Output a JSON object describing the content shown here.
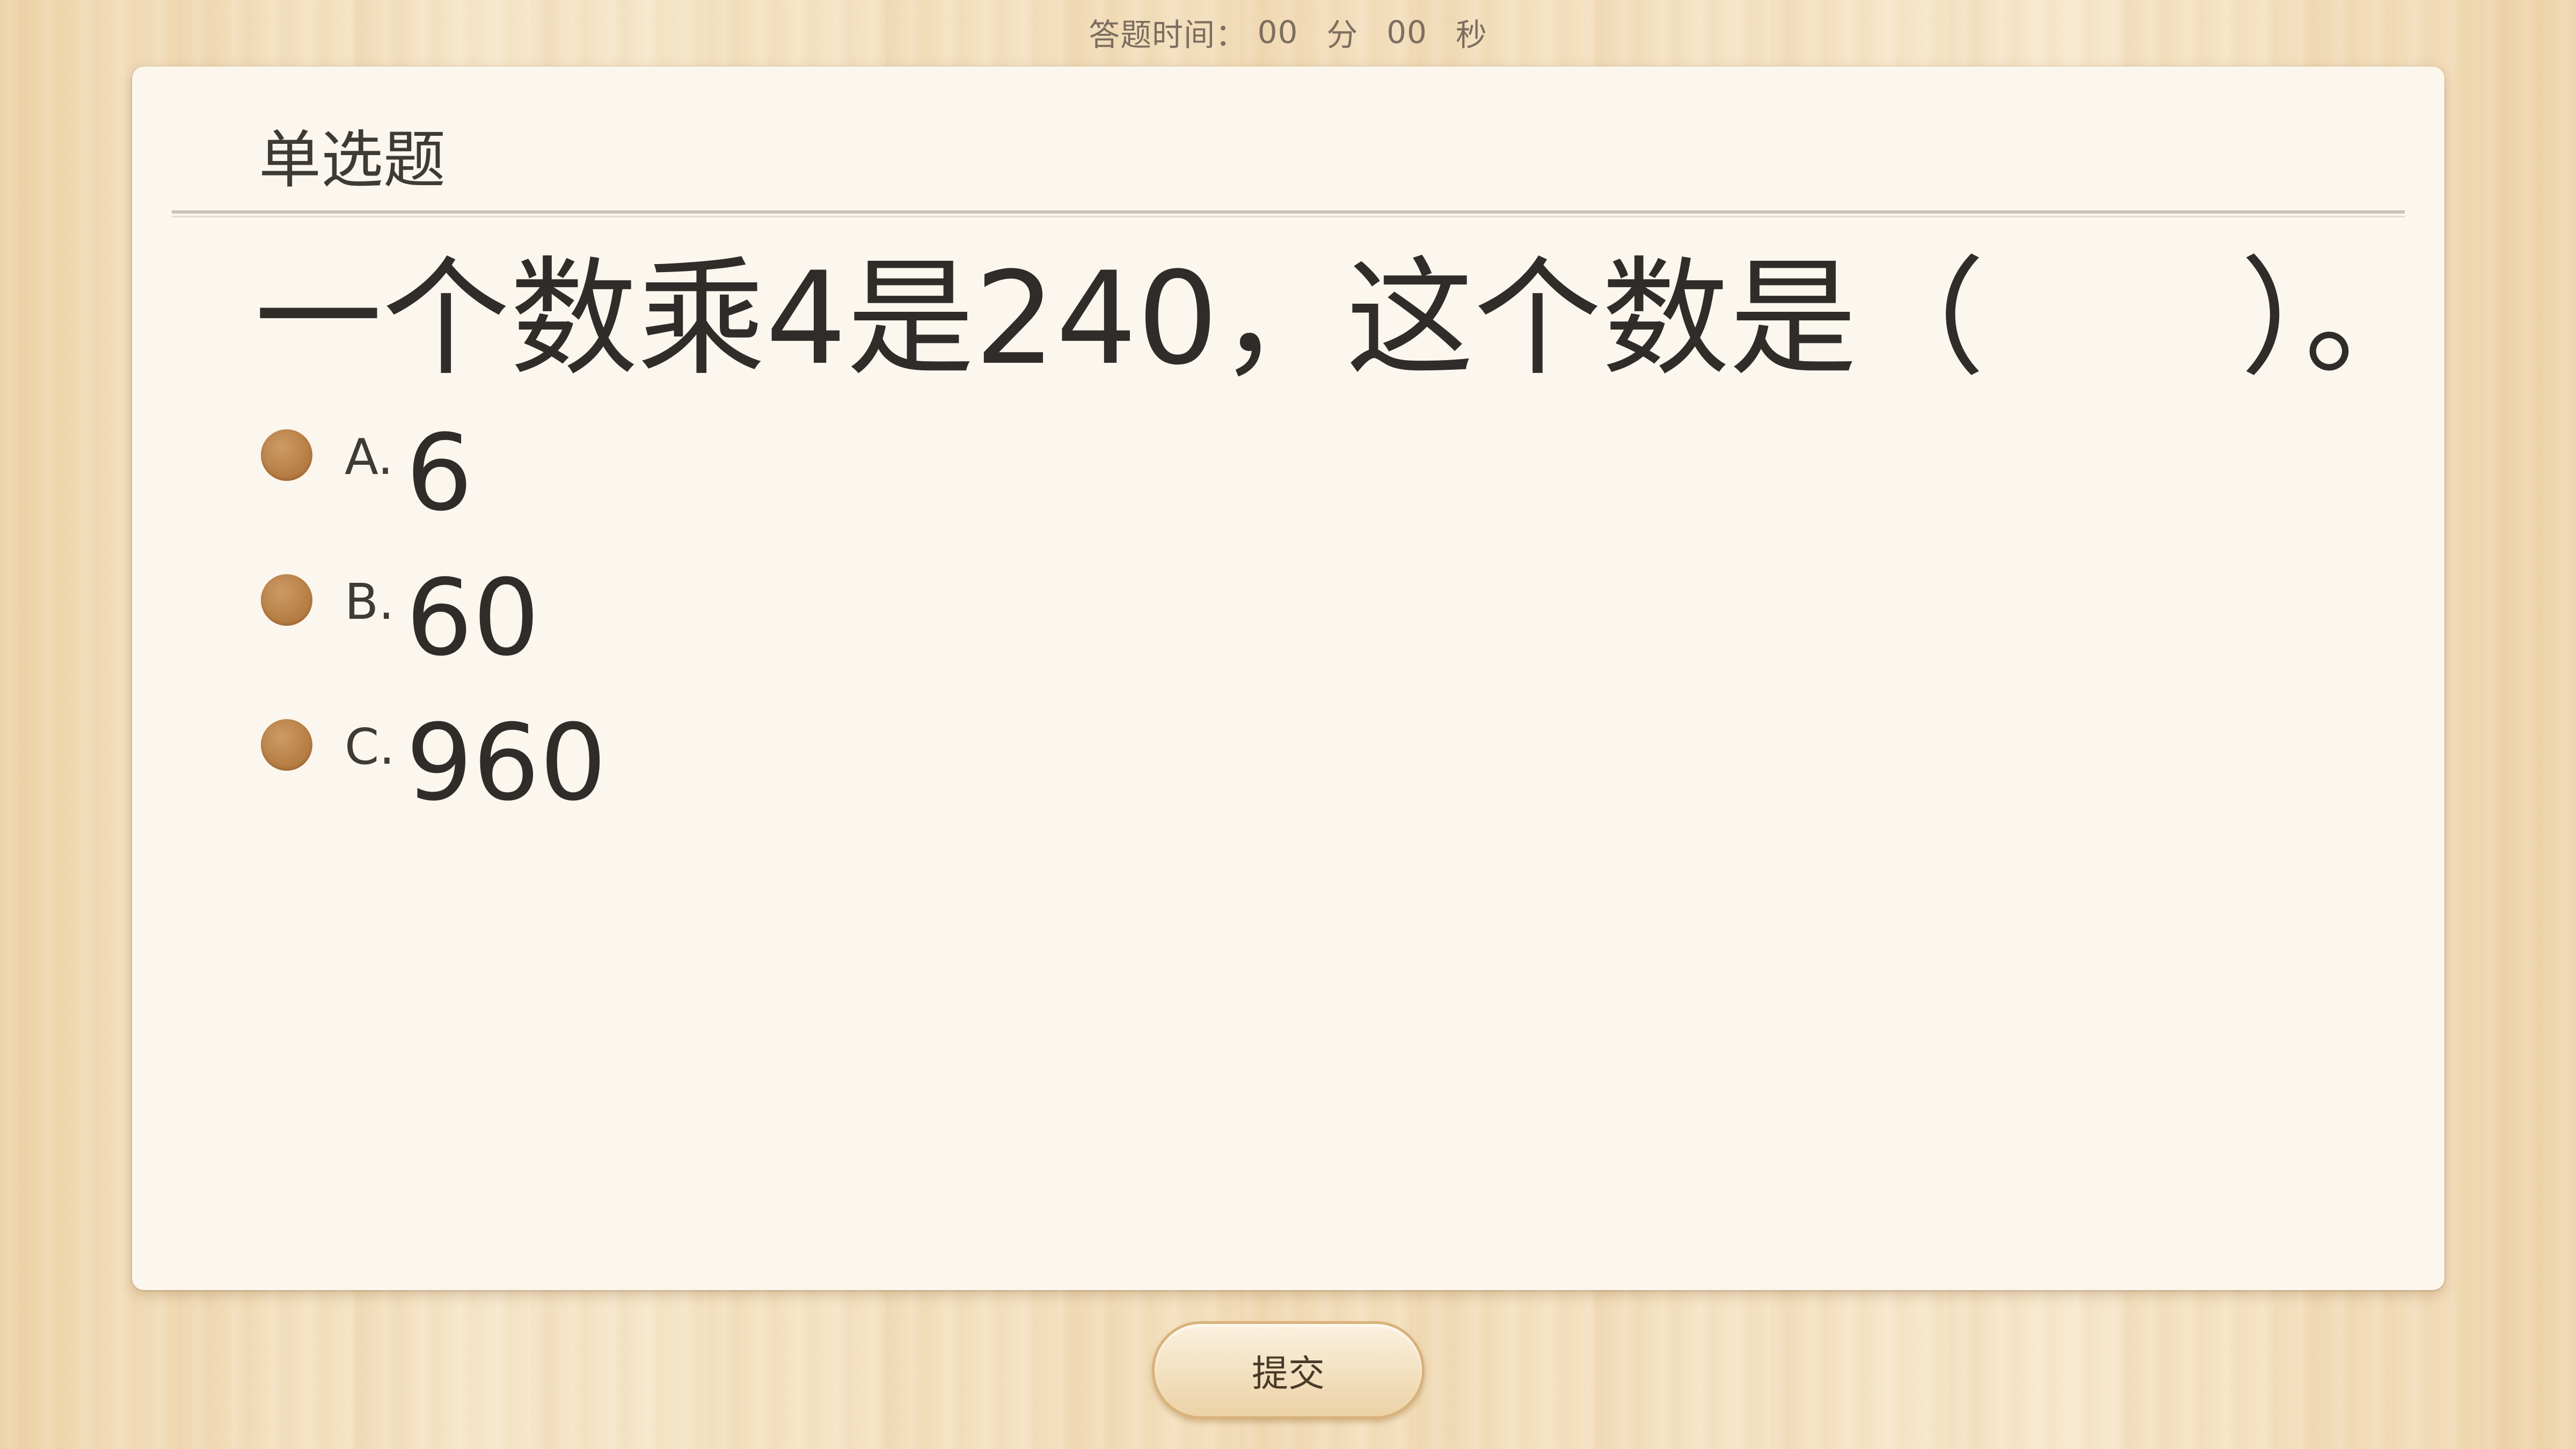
{
  "timer": {
    "label": "答题时间：",
    "minutes": "00",
    "minutes_unit": "分",
    "seconds": "00",
    "seconds_unit": "秒"
  },
  "card": {
    "header": "单选题",
    "question": "一个数乘4是240，这个数是（　　）。",
    "options": [
      {
        "letter": "A.",
        "value": "6"
      },
      {
        "letter": "B.",
        "value": "60"
      },
      {
        "letter": "C.",
        "value": "960"
      }
    ]
  },
  "submit": {
    "label": "提交"
  },
  "colors": {
    "radio": "#b98147",
    "card_bg": "#fbf6ee",
    "wood_bg": "#f3dfbd",
    "text": "#2f2c2a"
  }
}
